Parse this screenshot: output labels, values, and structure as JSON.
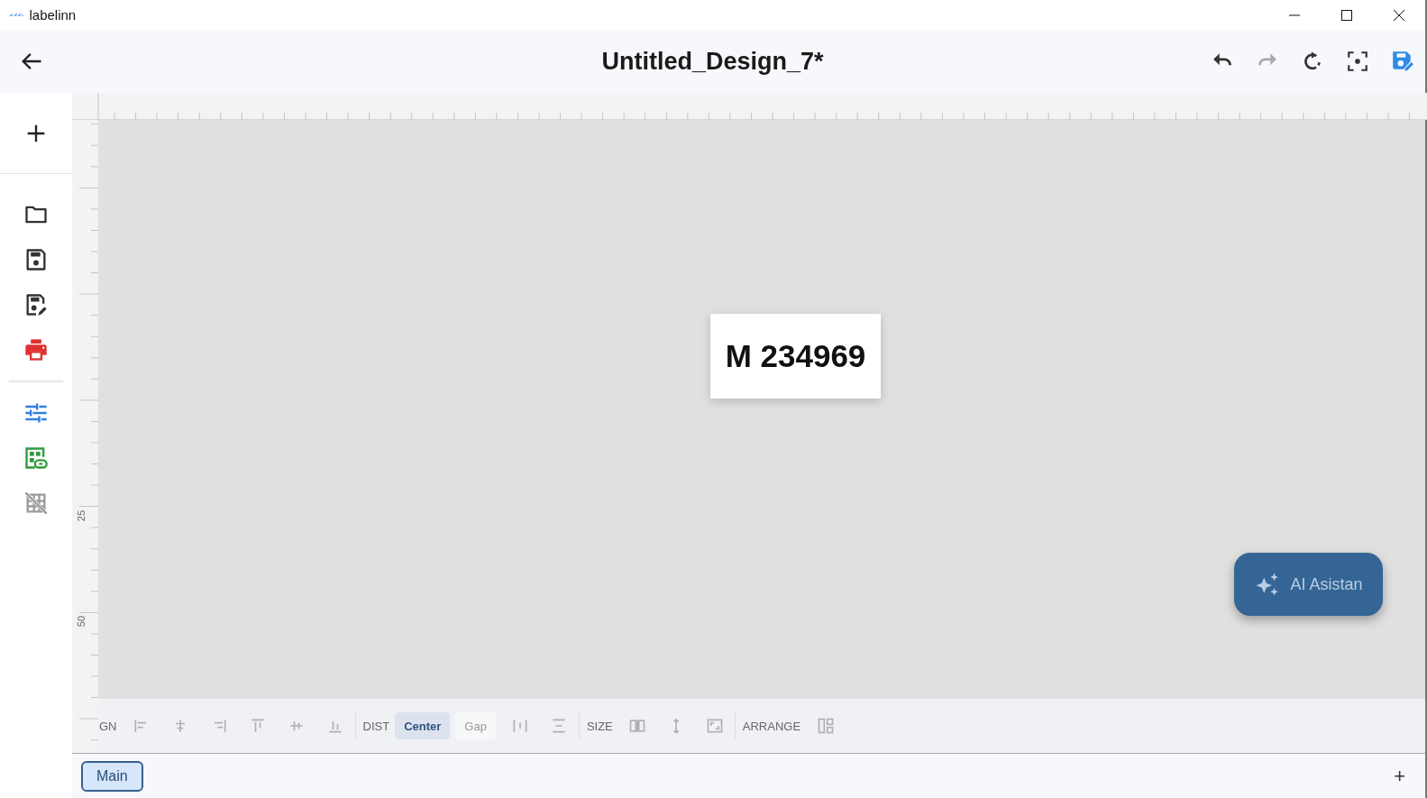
{
  "window": {
    "title": "labelinn"
  },
  "header": {
    "title": "Untitled_Design_7*",
    "actions": [
      {
        "kind": "undo",
        "disabled": false
      },
      {
        "kind": "redo",
        "disabled": true
      },
      {
        "kind": "refresh",
        "disabled": false
      },
      {
        "kind": "focus",
        "disabled": false
      },
      {
        "kind": "save-edit",
        "disabled": false
      }
    ]
  },
  "sidebar": {
    "add": {
      "kind": "add"
    },
    "groups": [
      {
        "items": [
          {
            "kind": "folder",
            "disabled": false
          },
          {
            "kind": "save",
            "disabled": false
          },
          {
            "kind": "save-as",
            "disabled": false
          },
          {
            "kind": "print",
            "disabled": false
          }
        ]
      },
      {
        "items": [
          {
            "kind": "sliders",
            "disabled": false
          },
          {
            "kind": "data-link",
            "disabled": false
          },
          {
            "kind": "grid-off",
            "disabled": true
          }
        ]
      }
    ]
  },
  "ruler": {
    "vertical_labels": [
      "25",
      "50"
    ]
  },
  "canvas": {
    "label": {
      "text": "M 234969"
    }
  },
  "assistant": {
    "label": "AI Asistan"
  },
  "toolbar": {
    "items": [
      {
        "kind": "text",
        "text": "GN"
      },
      {
        "kind": "align-left"
      },
      {
        "kind": "align-center"
      },
      {
        "kind": "align-right"
      },
      {
        "kind": "align-top"
      },
      {
        "kind": "align-middle"
      },
      {
        "kind": "align-bottom"
      },
      {
        "kind": "separator"
      },
      {
        "kind": "text",
        "text": "DIST"
      },
      {
        "kind": "toggle",
        "text": "Center",
        "selected": true
      },
      {
        "kind": "toggle",
        "text": "Gap",
        "selected": false
      },
      {
        "kind": "distribute-horizontal"
      },
      {
        "kind": "distribute-vertical"
      },
      {
        "kind": "separator"
      },
      {
        "kind": "text",
        "text": "SIZE"
      },
      {
        "kind": "size-width"
      },
      {
        "kind": "size-height"
      },
      {
        "kind": "size-both"
      },
      {
        "kind": "separator"
      },
      {
        "kind": "text",
        "text": "ARRANGE"
      },
      {
        "kind": "arrange"
      }
    ]
  },
  "pages": {
    "tabs": [
      {
        "label": "Main",
        "selected": true
      }
    ],
    "add": "+"
  }
}
